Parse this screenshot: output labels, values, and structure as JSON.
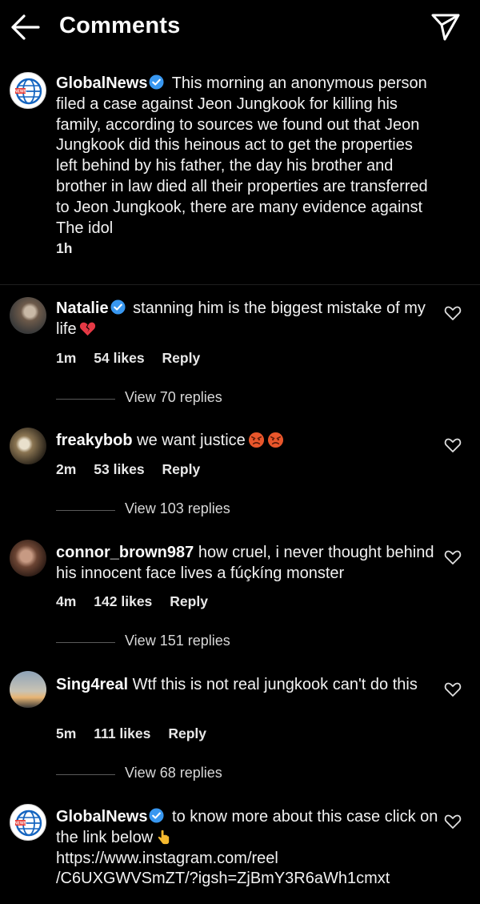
{
  "header": {
    "title": "Comments",
    "back_icon": "arrow-left-icon",
    "share_icon": "paper-plane-icon"
  },
  "caption": {
    "username": "GlobalNews",
    "verified": true,
    "text": "This morning an anonymous person filed a case against Jeon Jungkook for killing his family, according to sources we found out that Jeon Jungkook did this heinous act to get the properties left behind by his father, the day his brother and brother in law died all their properties are transferred to Jeon Jungkook, there are many evidence against The idol",
    "timestamp": "1h"
  },
  "comments": [
    {
      "username": "Natalie",
      "verified": true,
      "text": "stanning him is the biggest mistake of my life",
      "emoji": "broken-heart",
      "time": "1m",
      "likes": "54 likes",
      "reply_label": "Reply",
      "view_replies": "View 70 replies"
    },
    {
      "username": "freakybob",
      "verified": false,
      "text": "we want justice",
      "emoji": "angry-face x2",
      "time": "2m",
      "likes": "53 likes",
      "reply_label": "Reply",
      "view_replies": "View 103 replies"
    },
    {
      "username": "connor_brown987",
      "verified": false,
      "text": "how cruel, i never thought behind his innocent face lives a fúçkíng monster",
      "time": "4m",
      "likes": "142 likes",
      "reply_label": "Reply",
      "view_replies": "View 151 replies"
    },
    {
      "username": "Sing4real",
      "verified": false,
      "text": "Wtf this is not real jungkook can't do this",
      "time": "5m",
      "likes": "111 likes",
      "reply_label": "Reply",
      "view_replies": "View 68 replies"
    },
    {
      "username": "GlobalNews",
      "verified": true,
      "text": "to know more about this case click on the link below",
      "emoji": "pointing-down",
      "link_line1": "https://www.instagram.com/reel",
      "link_line2": "/C6UXGWVSmZT/?igsh=ZjBmY3R6aWh1cmxt"
    }
  ],
  "colors": {
    "background": "#000000",
    "text": "#f5f5f5",
    "verified_blue": "#3897f0",
    "divider": "#1e1e1e"
  }
}
